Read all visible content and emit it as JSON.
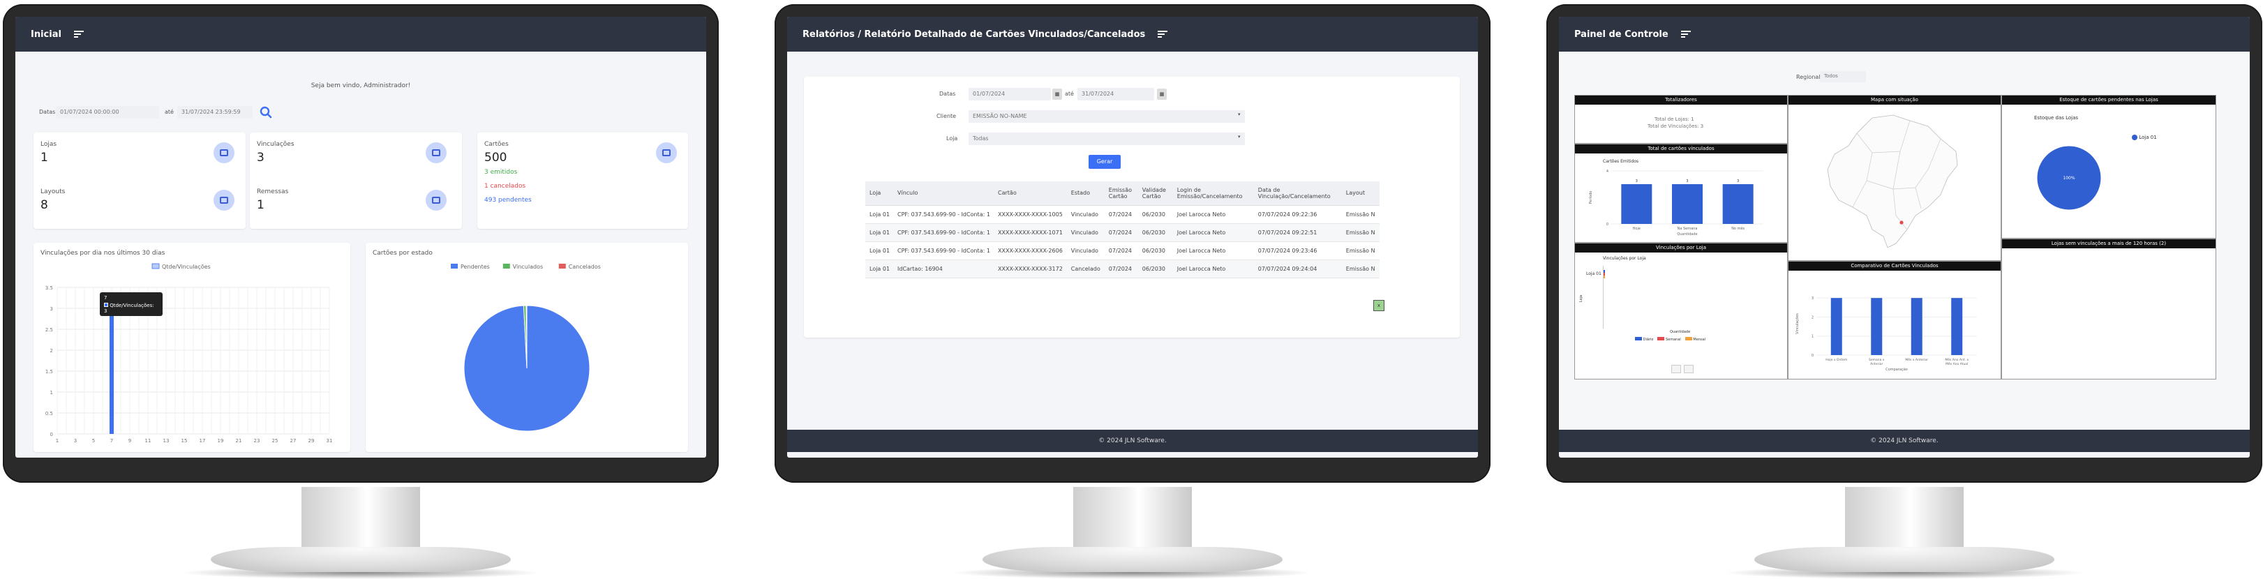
{
  "monitor1": {
    "topbar": {
      "title": "Inicial"
    },
    "welcome": "Seja bem vindo, Administrador!",
    "filter": {
      "label": "Datas:",
      "from": "01/07/2024 00:00:00",
      "sep": "até",
      "to": "31/07/2024 23:59:59"
    },
    "stats": [
      {
        "label": "Lojas",
        "value": "1"
      },
      {
        "label": "Layouts",
        "value": "8"
      },
      {
        "label": "Vinculações",
        "value": "3"
      },
      {
        "label": "Remessas",
        "value": "1"
      }
    ],
    "cartoes": {
      "label": "Cartões",
      "value": "500",
      "emitidos": "3 emitidos",
      "cancelados": "1 cancelados",
      "pendentes": "493 pendentes"
    },
    "line_title": "Vinculações por dia nos últimos 30 dias",
    "pie_title": "Cartões por estado",
    "tooltip": {
      "title": "7",
      "line": "Qtde/Vinculações: 3"
    },
    "colors": {
      "accent": "#3b6ff5",
      "green": "#3fae49",
      "red": "#e5484d"
    }
  },
  "chart_data": [
    {
      "type": "bar",
      "title": "Vinculações por dia nos últimos 30 dias",
      "series": [
        {
          "name": "Qtde/Vinculações",
          "values": [
            0,
            0,
            0,
            0,
            0,
            0,
            3,
            0,
            0,
            0,
            0,
            0,
            0,
            0,
            0,
            0,
            0,
            0,
            0,
            0,
            0,
            0,
            0,
            0,
            0,
            0,
            0,
            0,
            0,
            0,
            0
          ]
        }
      ],
      "x": [
        1,
        2,
        3,
        4,
        5,
        6,
        7,
        8,
        9,
        10,
        11,
        12,
        13,
        14,
        15,
        16,
        17,
        18,
        19,
        20,
        21,
        22,
        23,
        24,
        25,
        26,
        27,
        28,
        29,
        30,
        31
      ],
      "xticks": [
        "1",
        "3",
        "5",
        "7",
        "9",
        "11",
        "13",
        "15",
        "17",
        "19",
        "21",
        "23",
        "25",
        "27",
        "29",
        "31"
      ],
      "yticks": [
        "0",
        "0.5",
        "1",
        "1.5",
        "2",
        "2.5",
        "3",
        "3.5"
      ],
      "ylim": [
        0,
        3.5
      ]
    },
    {
      "type": "pie",
      "title": "Cartões por estado",
      "labels": [
        "Pendentes",
        "Vinculados",
        "Cancelados"
      ],
      "values": [
        493,
        3,
        1
      ],
      "colors": [
        "#4a7cf0",
        "#5ab55e",
        "#e25c5c"
      ]
    },
    {
      "type": "bar",
      "title": "Cartões Emitidos",
      "categories": [
        "Hoje",
        "Na Semana",
        "No mês"
      ],
      "values": [
        3,
        3,
        3
      ],
      "ylabel": "Período",
      "xlabel": "Quantidade",
      "yticks": [
        "0",
        "4"
      ],
      "ylim": [
        0,
        4
      ]
    },
    {
      "type": "bar",
      "title": "Comparativo de Cartões Vinculados",
      "categories": [
        "Hoje x Ontem",
        "Semana x Anterior",
        "Mês x Anterior",
        "Mês Ano Ant. x Mês Ano Atual"
      ],
      "values": [
        3,
        3,
        3,
        3
      ],
      "ylabel": "Vinculações",
      "xlabel": "Comparação",
      "yticks": [
        "0",
        "1",
        "2",
        "3"
      ],
      "ylim": [
        0,
        3.3
      ]
    },
    {
      "type": "pie",
      "title": "Estoque das Lojas",
      "labels": [
        "Loja 01"
      ],
      "values": [
        100
      ],
      "colors": [
        "#2f5fd0"
      ],
      "slice_label": "100%"
    }
  ],
  "monitor2": {
    "topbar": {
      "title": "Relatórios / Relatório Detalhado de Cartões Vinculados/Cancelados"
    },
    "form": {
      "datas_label": "Datas",
      "from": "01/07/2024",
      "sep": "até",
      "to": "31/07/2024",
      "cliente_label": "Cliente",
      "cliente_value": "EMISSÃO NO-NAME",
      "loja_label": "Loja",
      "loja_value": "Todas",
      "button": "Gerar"
    },
    "table": {
      "headers": [
        "Loja",
        "Vínculo",
        "Cartão",
        "Estado",
        "Emissão Cartão",
        "Validade Cartão",
        "Login de Emissão/Cancelamento",
        "Data de Vinculação/Cancelamento",
        "Layout"
      ],
      "rows": [
        [
          "Loja 01",
          "CPF: 037.543.699-90 - IdConta: 1",
          "XXXX-XXXX-XXXX-1005",
          "Vinculado",
          "07/2024",
          "06/2030",
          "Joel Larocca Neto",
          "07/07/2024 09:22:36",
          "Emissão N"
        ],
        [
          "Loja 01",
          "CPF: 037.543.699-90 - IdConta: 1",
          "XXXX-XXXX-XXXX-1071",
          "Vinculado",
          "07/2024",
          "06/2030",
          "Joel Larocca Neto",
          "07/07/2024 09:22:51",
          "Emissão N"
        ],
        [
          "Loja 01",
          "CPF: 037.543.699-90 - IdConta: 1",
          "XXXX-XXXX-XXXX-2606",
          "Vinculado",
          "07/2024",
          "06/2030",
          "Joel Larocca Neto",
          "07/07/2024 09:23:46",
          "Emissão N"
        ],
        [
          "Loja 01",
          "IdCartao: 16904",
          "XXXX-XXXX-XXXX-3172",
          "Cancelado",
          "07/2024",
          "06/2030",
          "Joel Larocca Neto",
          "07/07/2024 09:24:04",
          "Emissão N"
        ]
      ]
    },
    "footer": "© 2024 JLN Software."
  },
  "monitor3": {
    "topbar": {
      "title": "Painel de Controle"
    },
    "regional_label": "Regional:",
    "regional_value": "Todos",
    "totalizadores": {
      "title": "Totalizadores",
      "lojas": "Total de Lojas: 1",
      "vinc": "Total de Vinculações: 3"
    },
    "mapa_title": "Mapa com situação",
    "estoque_header": "Estoque de cartões pendentes nas Lojas",
    "estoque_title": "Estoque das Lojas",
    "estoque_legend": "Loja 01",
    "total_vinc_header": "Total de cartões vinculados",
    "emitidos_title": "Cartões Emitidos",
    "vinc_loja_header": "Vinculações por Loja",
    "vinc_loja_title": "Vinculações por Loja",
    "vinc_loja_ylabel": "Loja",
    "vinc_loja_cat": "Loja 01",
    "vinc_loja_xlabel": "Quantidade",
    "vinc_loja_legend": [
      "Diário",
      "Semanal",
      "Mensal"
    ],
    "comparativo_header": "Comparativo de Cartões Vinculados",
    "lojas_sem_header": "Lojas sem vinculações a mais de 120 horas (2)",
    "footer": "© 2024 JLN Software."
  }
}
